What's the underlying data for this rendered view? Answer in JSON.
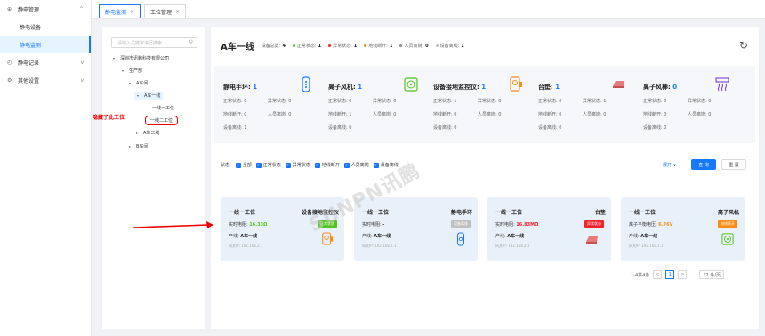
{
  "sidebar": {
    "groups": [
      {
        "label": "静电管理",
        "icon": "shield-icon",
        "chevron": "^"
      },
      {
        "label": "静电记录",
        "icon": "record-icon",
        "chevron": "v"
      },
      {
        "label": "其他设置",
        "icon": "gear-icon",
        "chevron": "v"
      }
    ],
    "items": [
      "静电设备",
      "静电监测"
    ]
  },
  "tabs": [
    {
      "label": "静电监测",
      "close": "×"
    },
    {
      "label": "工位管理",
      "close": "×"
    }
  ],
  "tree": {
    "search_placeholder": "请输入关键字进行搜索",
    "nodes": [
      "深圳市讯鹏科技有限公司",
      "生产部",
      "A车间",
      "A车一线",
      "一线一工位",
      "一线二工位",
      "A车二线",
      "B车间"
    ]
  },
  "annotation": "隐藏了此工位",
  "watermark": "SUNPN讯鹏",
  "header": {
    "title": "A车一线",
    "stats": [
      {
        "label": "设备总数:",
        "value": "4",
        "color": ""
      },
      {
        "label": "正常状态:",
        "value": "1",
        "color": "#52c41a"
      },
      {
        "label": "异常状态:",
        "value": "1",
        "color": "#f5222d"
      },
      {
        "label": "地线断开:",
        "value": "1",
        "color": "#fa8c16"
      },
      {
        "label": "人员离岗:",
        "value": "0",
        "color": "#8c8c8c"
      },
      {
        "label": "设备离线:",
        "value": "1",
        "color": "#bfbfbf"
      }
    ]
  },
  "devices": [
    {
      "name": "静电手环:",
      "count": "1",
      "icon": "wristband-icon",
      "l1": "正常状态: 0",
      "r1": "异常状态: 0",
      "l2": "地线断开: 0",
      "r2": "人员离岗: 0",
      "l3": "设备离线: 1"
    },
    {
      "name": "离子风机:",
      "count": "1",
      "icon": "ion-fan-icon",
      "l1": "正常状态: 0",
      "r1": "异常状态: 0",
      "l2": "地线断开: 1",
      "r2": "人员离岗: 0",
      "l3": "设备离线: 0"
    },
    {
      "name": "设备接地监控仪:",
      "count": "1",
      "icon": "ground-monitor-icon",
      "l1": "正常状态: 1",
      "r1": "异常状态: 0",
      "l2": "地线断开: 0",
      "r2": "人员离岗: 0",
      "l3": "设备离线: 0"
    },
    {
      "name": "台垫:",
      "count": "1",
      "icon": "table-mat-icon",
      "l1": "正常状态: 0",
      "r1": "异常状态: 1",
      "l2": "地线断开: 0",
      "r2": "人员离岗: 0",
      "l3": "设备离线: 0"
    },
    {
      "name": "离子风棒:",
      "count": "0",
      "icon": "ion-bar-icon",
      "l1": "正常状态: 0",
      "r1": "异常状态: 0",
      "l2": "地线断开: 0",
      "r2": "人员离岗: 0",
      "l3": "设备离线: 0"
    }
  ],
  "filter": {
    "label": "状态:",
    "options": [
      "全部",
      "正常状态",
      "异常状态",
      "地线断开",
      "人员离岗",
      "设备离线"
    ],
    "expand": "展开 ∨",
    "query": "查 询",
    "reset": "重 置"
  },
  "cards": [
    {
      "loc": "一线一工位",
      "type": "设备接地监控仪",
      "val_label": "实时电阻:",
      "val": "16.33Ω",
      "val_color": "#52c41a",
      "badge": "正常状态",
      "badge_color": "#52c41a",
      "line": "产线:",
      "line_val": "A车一线",
      "net": "网关IP: 192.168.2.1",
      "icon": "ground-monitor-icon"
    },
    {
      "loc": "一线一工位",
      "type": "静电手环",
      "val_label": "实时电阻:",
      "val": "-",
      "val_color": "#333",
      "badge": "设备离线",
      "badge_color": "#bfbfbf",
      "line": "产线:",
      "line_val": "A车一线",
      "net": "网关IP: 192.168.2.1",
      "icon": "wristband-icon"
    },
    {
      "loc": "一线一工位",
      "type": "台垫",
      "val_label": "实时电阻:",
      "val": "16.83MΩ",
      "val_color": "#f5222d",
      "badge": "异常状态",
      "badge_color": "#f5222d",
      "line": "产线:",
      "line_val": "A车一线",
      "net": "网关IP: 192.168.2.1",
      "icon": "table-mat-icon"
    },
    {
      "loc": "一线一工位",
      "type": "离子风机",
      "val_label": "离子平衡电压:",
      "val": "6.76V",
      "val_color": "#fa8c16",
      "badge": "地线断开",
      "badge_color": "#fa8c16",
      "line": "产线:",
      "line_val": "A车一线",
      "net": "网关IP: 192.168.2.1",
      "icon": "ion-fan-icon"
    }
  ],
  "pager": {
    "total": "1-4共4条",
    "prev": "<",
    "page": "1",
    "next": ">",
    "size": "12 条/页"
  },
  "colors": {
    "accent": "#1677ff",
    "normal": "#52c41a",
    "error": "#f5222d",
    "ground": "#fa8c16",
    "offline": "#bfbfbf"
  }
}
